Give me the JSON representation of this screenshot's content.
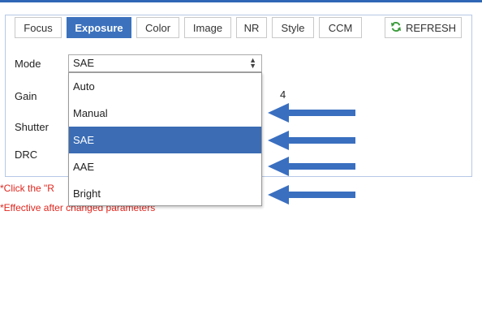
{
  "tabs": [
    {
      "label": "Focus",
      "active": false
    },
    {
      "label": "Exposure",
      "active": true
    },
    {
      "label": "Color",
      "active": false
    },
    {
      "label": "Image",
      "active": false
    },
    {
      "label": "NR",
      "active": false
    },
    {
      "label": "Style",
      "active": false
    },
    {
      "label": "CCM",
      "active": false
    }
  ],
  "refresh_label": "REFRESH",
  "refresh_icon": "refresh-icon",
  "fields": {
    "mode": "Mode",
    "gain": "Gain",
    "shutter": "Shutter",
    "drc": "DRC"
  },
  "mode_select": {
    "value": "SAE",
    "options": [
      "Auto",
      "Manual",
      "SAE",
      "AAE",
      "Bright"
    ],
    "highlighted": "SAE"
  },
  "gain_value": "4",
  "notes": {
    "click_prefix": "*Click the \"R",
    "effective": "*Effective after changed parameters"
  },
  "colors": {
    "accent": "#3c72bd",
    "highlight": "#3b6cb4",
    "note": "#e0271f",
    "arrow": "#3a6fc0"
  },
  "annotation_arrows": {
    "count": 4,
    "points_to": [
      "Manual",
      "SAE",
      "AAE",
      "Bright"
    ]
  }
}
